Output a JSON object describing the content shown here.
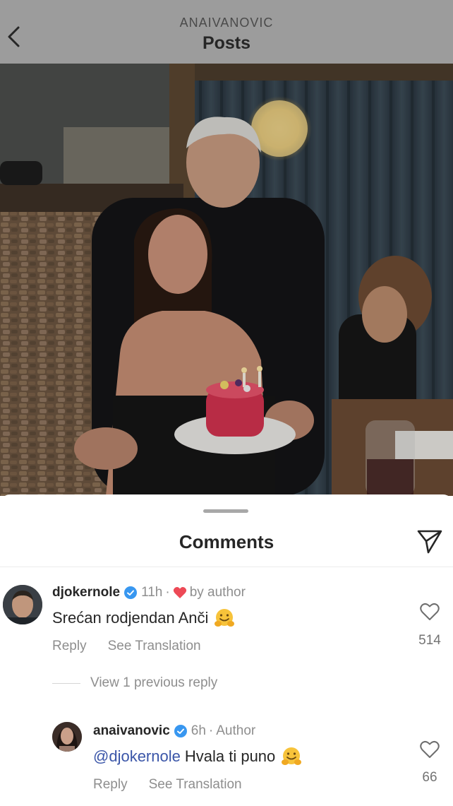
{
  "header": {
    "username": "ANAIVANOVIC",
    "title": "Posts"
  },
  "post": {
    "photo_icon": "photo-birthday-cake"
  },
  "comments_sheet": {
    "title": "Comments",
    "share_icon": "paper-plane-icon"
  },
  "comments": [
    {
      "username": "djokernole",
      "verified": true,
      "time": "11h",
      "liked_by_author": "by author",
      "text": "Srećan rodjendan Anči",
      "reply_label": "Reply",
      "translate_label": "See Translation",
      "likes": "514"
    }
  ],
  "view_previous": "View 1 previous reply",
  "reply": {
    "username": "anaivanovic",
    "verified": true,
    "time": "6h",
    "role": "Author",
    "mention": "@djokernole",
    "text": "Hvala ti puno",
    "reply_label": "Reply",
    "translate_label": "See Translation",
    "likes": "66"
  },
  "colors": {
    "header_bg": "#9c9c9c",
    "verified_blue": "#3897f0",
    "heart_red": "#ed4956",
    "mention_blue": "#3a55a8"
  }
}
